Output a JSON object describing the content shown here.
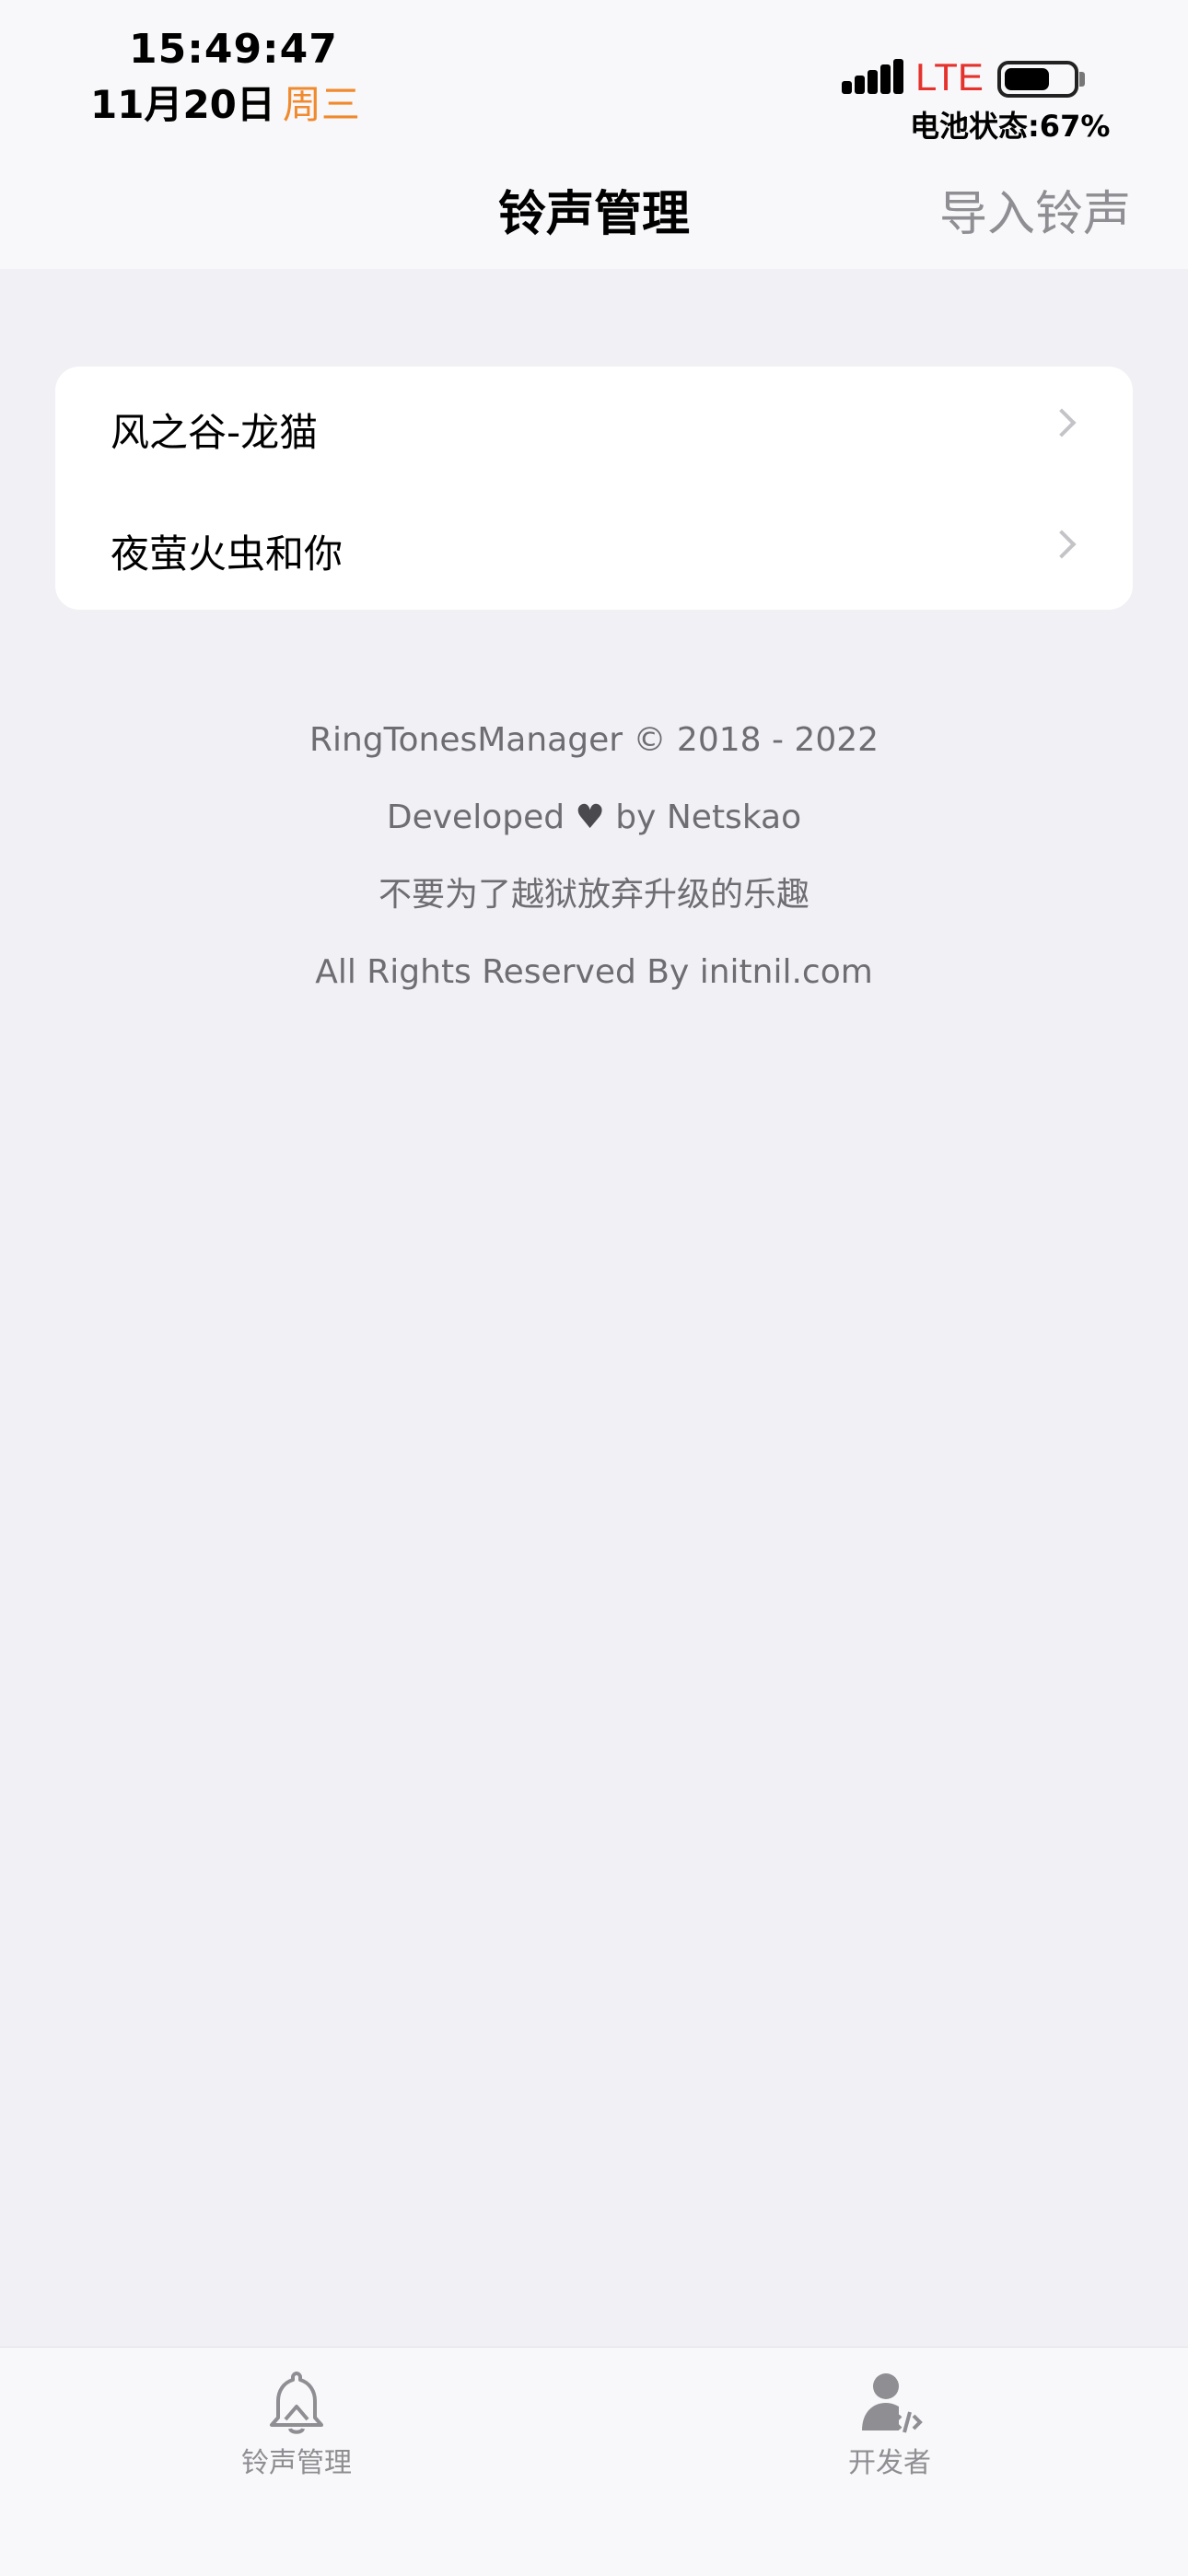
{
  "status_bar": {
    "time": "15:49:47",
    "date": "11月20日",
    "weekday": "周三",
    "network": "LTE",
    "battery_text": "电池状态:67%",
    "battery_level": 0.67
  },
  "nav": {
    "title": "铃声管理",
    "action": "导入铃声"
  },
  "ringtones": [
    {
      "label": "风之谷-龙猫"
    },
    {
      "label": "夜萤火虫和你"
    }
  ],
  "footer": {
    "line1": "RingTonesManager © 2018 - 2022",
    "line2_pre": "Developed",
    "line2_heart": "♥",
    "line2_post": "by Netskao",
    "line3": "不要为了越狱放弃升级的乐趣",
    "line4": "All Rights Reserved By initnil.com"
  },
  "tabs": [
    {
      "label": "铃声管理",
      "icon": "bell-icon"
    },
    {
      "label": "开发者",
      "icon": "developer-icon"
    }
  ],
  "colors": {
    "accent_weekday": "#f08a2e",
    "lte": "#e5322d",
    "background": "#f0f0f5"
  }
}
